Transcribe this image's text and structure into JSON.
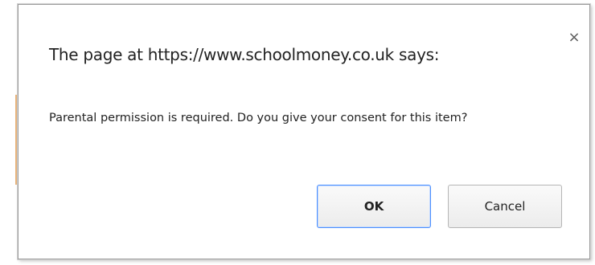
{
  "dialog": {
    "title": "The page at https://www.schoolmoney.co.uk says:",
    "message": "Parental permission is required. Do you give your consent for this item?",
    "close_icon": "close-icon",
    "close_glyph": "×",
    "ok_label": "OK",
    "cancel_label": "Cancel"
  },
  "colors": {
    "default_button_border": "#4d90fe",
    "page_accent": "#e6b27a"
  }
}
